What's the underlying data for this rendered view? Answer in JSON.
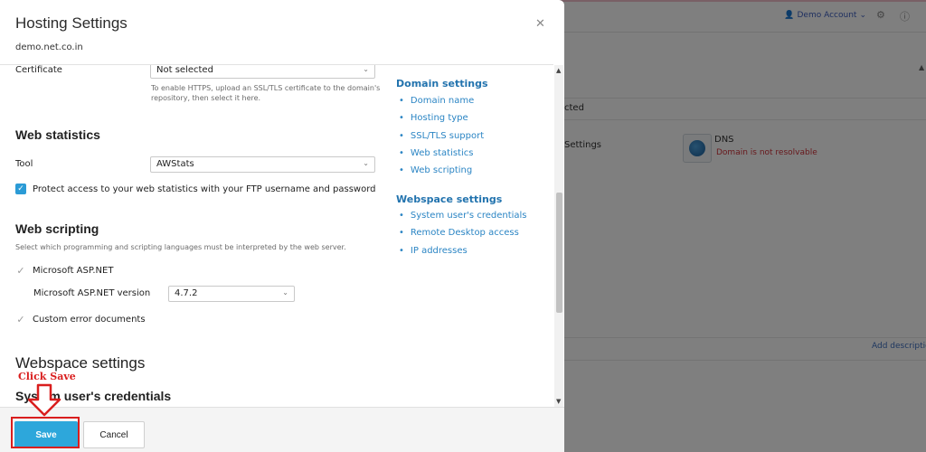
{
  "background": {
    "account_label": "Demo Account",
    "row1_text": "cted",
    "row2_text": "Settings",
    "dns_title": "DNS",
    "dns_status": "Domain is not resolvable",
    "add_description": "Add descriptio"
  },
  "modal": {
    "title": "Hosting Settings",
    "subtitle": "demo.net.co.in",
    "certificate": {
      "label": "Certificate",
      "value": "Not selected",
      "hint_line1": "To enable HTTPS, upload an SSL/TLS certificate to the domain's",
      "hint_line2": "repository, then select it here."
    },
    "web_statistics": {
      "heading": "Web statistics",
      "tool_label": "Tool",
      "tool_value": "AWStats",
      "protect_label": "Protect access to your web statistics with your FTP username and password",
      "protect_checked": true
    },
    "web_scripting": {
      "heading": "Web scripting",
      "description": "Select which programming and scripting languages must be interpreted by the web server.",
      "aspnet_label": "Microsoft ASP.NET",
      "aspnet_version_label": "Microsoft ASP.NET version",
      "aspnet_version_value": "4.7.2",
      "custom_errors_label": "Custom error documents"
    },
    "webspace": {
      "heading": "Webspace settings",
      "sub_heading": "System user's credentials"
    },
    "toc": {
      "domain_heading": "Domain settings",
      "domain_items": [
        "Domain name",
        "Hosting type",
        "SSL/TLS support",
        "Web statistics",
        "Web scripting"
      ],
      "webspace_heading": "Webspace settings",
      "webspace_items": [
        "System user's credentials",
        "Remote Desktop access",
        "IP addresses"
      ]
    },
    "footer": {
      "save_label": "Save",
      "cancel_label": "Cancel"
    },
    "annotation": {
      "text": "Click Save",
      "color": "#d91e1e"
    }
  },
  "colors": {
    "accent": "#2da7db",
    "link": "#2b85c4",
    "error": "#d91e1e"
  }
}
